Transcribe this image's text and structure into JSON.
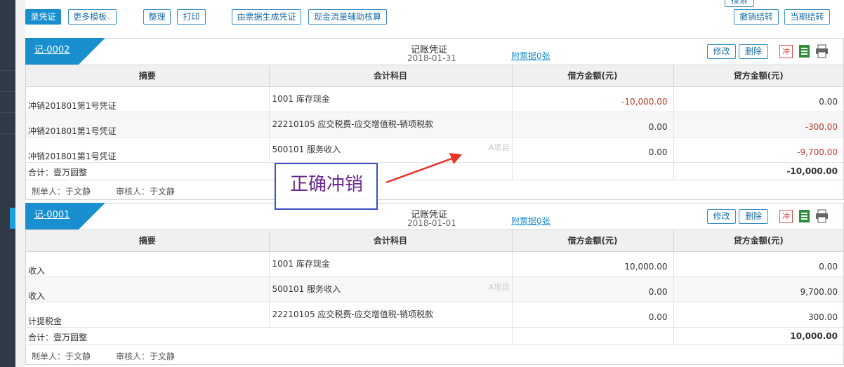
{
  "toolbar": {
    "record": "录凭证",
    "more_templates": "更多模板",
    "organize": "整理",
    "print": "打印",
    "gen_from_receipt": "由票据生成凭证",
    "cashflow": "现金流量辅助核算",
    "search": "搜索",
    "undo_close": "撤销结转",
    "period_close": "当期结转"
  },
  "columns": [
    "摘要",
    "会计科目",
    "借方金额(元)",
    "贷方金额(元)"
  ],
  "labels": {
    "edit": "修改",
    "delete": "删除",
    "reverse": "冲"
  },
  "vouchers": [
    {
      "no": "记-0002",
      "title": "记账凭证",
      "date": "2018-01-31",
      "attach": "附票据0张",
      "rows": [
        {
          "summary": "冲销201801第1号凭证",
          "account": "1001 库存现金",
          "project": "",
          "debit": "-10,000.00",
          "credit": "0.00"
        },
        {
          "summary": "冲销201801第1号凭证",
          "account": "22210105 应交税费-应交增值税-销项税款",
          "project": "",
          "debit": "0.00",
          "credit": "-300.00"
        },
        {
          "summary": "冲销201801第1号凭证",
          "account": "500101 服务收入",
          "project": "A项目",
          "debit": "0.00",
          "credit": "-9,700.00"
        }
      ],
      "total_label": "合计：壹万圆整",
      "total_value": "-10,000.00",
      "maker": "制单人：于文静",
      "reviewer": "审核人：于文静"
    },
    {
      "no": "记-0001",
      "title": "记账凭证",
      "date": "2018-01-01",
      "attach": "附票据0张",
      "rows": [
        {
          "summary": "收入",
          "account": "1001 库存现金",
          "project": "",
          "debit": "10,000.00",
          "credit": "0.00"
        },
        {
          "summary": "收入",
          "account": "500101 服务收入",
          "project": "A项目",
          "debit": "0.00",
          "credit": "9,700.00"
        },
        {
          "summary": "计提税金",
          "account": "22210105 应交税费-应交增值税-销项税款",
          "project": "",
          "debit": "0.00",
          "credit": "300.00"
        }
      ],
      "total_label": "合计：壹万圆整",
      "total_value": "10,000.00",
      "maker": "制单人：于文静",
      "reviewer": "审核人：于文静"
    }
  ],
  "annotation": {
    "text": "正确冲销"
  },
  "colors": {
    "accent": "#1a8fd0",
    "negative": "#c0392b",
    "annotation": "#6b2a8f"
  }
}
